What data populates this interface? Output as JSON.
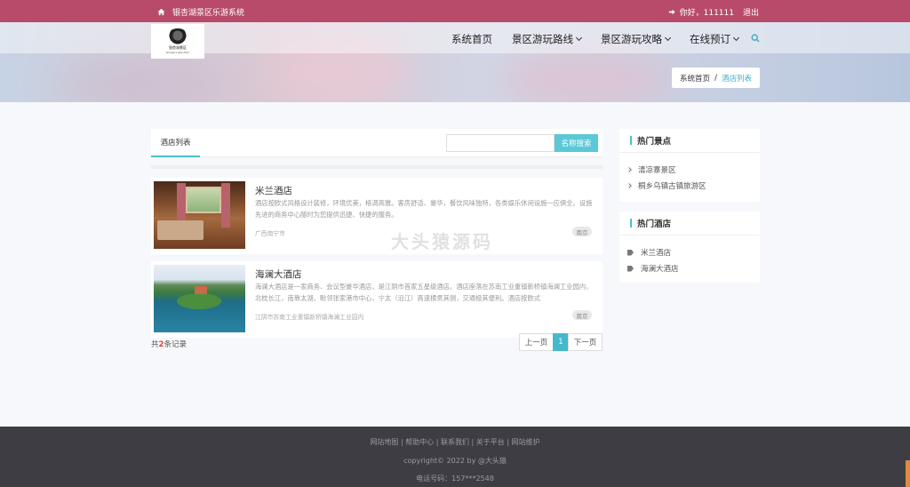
{
  "topbar": {
    "site_name": "银杏湖景区乐游系统",
    "greeting": "你好，111111",
    "logout": "退出"
  },
  "logo": {
    "text": "银杏湖景区",
    "sub": "Ginkgo Lake Park"
  },
  "nav": {
    "items": [
      {
        "label": "系统首页",
        "dropdown": false
      },
      {
        "label": "景区游玩路线",
        "dropdown": true
      },
      {
        "label": "景区游玩攻略",
        "dropdown": true
      },
      {
        "label": "在线预订",
        "dropdown": true
      }
    ]
  },
  "breadcrumb": {
    "home": "系统首页",
    "sep": "/",
    "current": "酒店列表"
  },
  "tabs": {
    "active": "酒店列表"
  },
  "search": {
    "placeholder": "",
    "button": "名称搜索"
  },
  "hotels": [
    {
      "title": "米兰酒店",
      "desc": "酒店按欧式风格设计装修，环境优美，格调高雅。客房舒适、豪华，餐饮风味独特，各类娱乐休闲设施一应俱全。设施先进的商务中心随时为您提供迅捷、快捷的服务。",
      "address": "广西南宁市",
      "tag": "南京"
    },
    {
      "title": "海澜大酒店",
      "desc": "海澜大酒店是一家商务、会议型豪华酒店，是江阴市首家五星级酒店。酒店座落在苏南工业重镇新桥镇海澜工业园内，北枕长江，南靠太湖，毗邻张家港市中心，宁太（沿江）高速横贯其侧，交通极其便利。酒店按欧式",
      "address": "江阴市苏南工业重镇新桥镇海澜工业园内",
      "tag": "南京"
    }
  ],
  "pagination": {
    "prefix": "共",
    "count": "2",
    "suffix": "条记录",
    "prev": "上一页",
    "current": "1",
    "next": "下一页"
  },
  "sidebar": {
    "hot_spots": {
      "title": "热门景点",
      "items": [
        "清凉寨景区",
        "桐乡乌镇古镇旅游区"
      ]
    },
    "hot_hotels": {
      "title": "热门酒店",
      "items": [
        "米兰酒店",
        "海澜大酒店"
      ]
    }
  },
  "watermark": "大头猿源码",
  "footer": {
    "links": "网站地图 | 帮助中心 | 联系我们 | 关于平台 | 网站维护",
    "copyright": "copyright© 2022 by @大头猿",
    "phone": "电话号码：157***2548"
  },
  "colors": {
    "topbar": "#b84b6a",
    "accent": "#4bbfcf",
    "footer": "#3d3d43"
  }
}
